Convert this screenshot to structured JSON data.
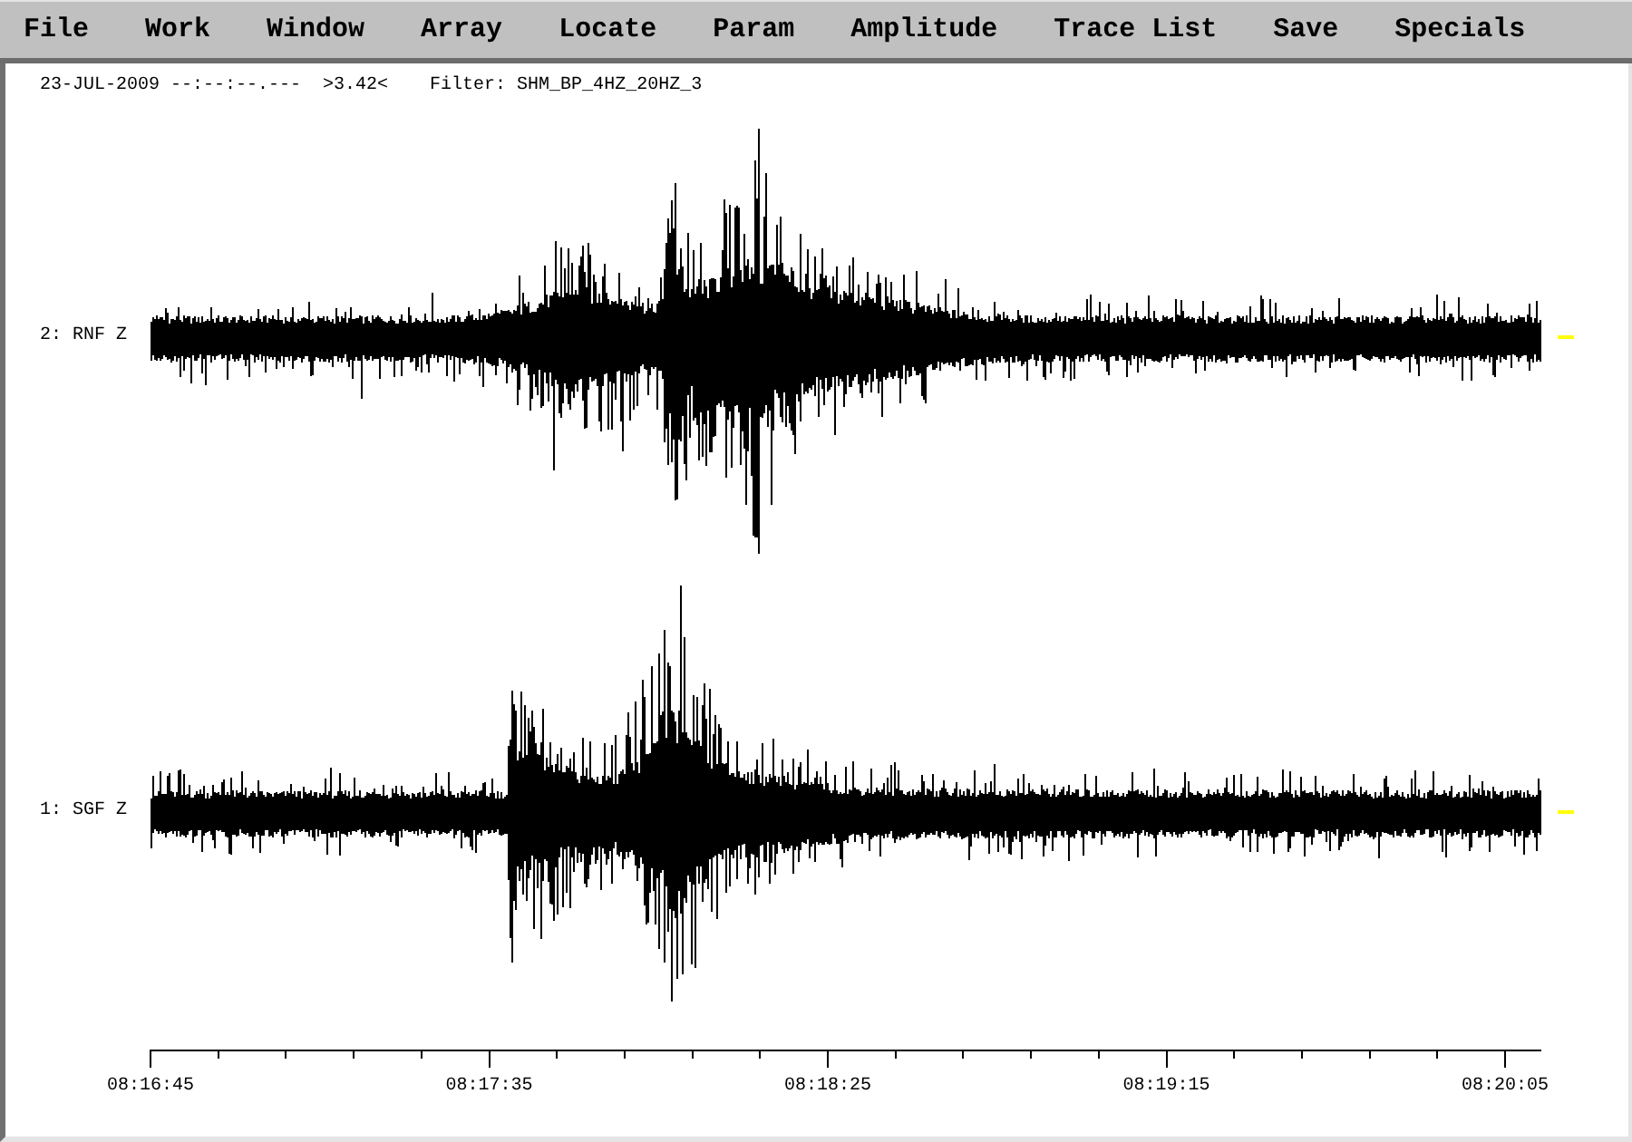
{
  "menu": [
    "File",
    "Work",
    "Window",
    "Array",
    "Locate",
    "Param",
    "Amplitude",
    "Trace List",
    "Save",
    "Specials"
  ],
  "header": {
    "date_time": "23-JUL-2009 --:--:--.---",
    "amplitude": ">3.42<",
    "filter": "Filter: SHM_BP_4HZ_20HZ_3"
  },
  "traces": [
    {
      "label": "2: RNF Z"
    },
    {
      "label": "1: SGF Z"
    }
  ],
  "time_axis": {
    "labels": [
      "08:16:45",
      "08:17:35",
      "08:18:25",
      "08:19:15",
      "08:20:05"
    ]
  }
}
